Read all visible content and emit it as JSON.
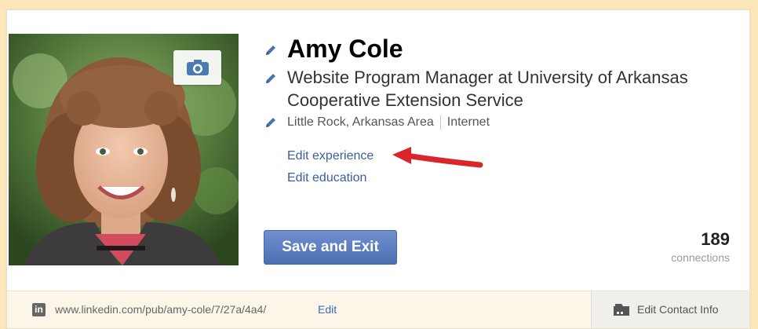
{
  "profile": {
    "name": "Amy Cole",
    "headline": "Website Program Manager at University of Arkansas Cooperative Extension Service",
    "location": "Little Rock, Arkansas Area",
    "industry": "Internet"
  },
  "actions": {
    "edit_experience": "Edit experience",
    "edit_education": "Edit education",
    "save_exit": "Save and Exit"
  },
  "connections": {
    "count": "189",
    "label": "connections"
  },
  "footer": {
    "linkedin_badge": "in",
    "public_url": "www.linkedin.com/pub/amy-cole/7/27a/4a4/",
    "url_edit": "Edit",
    "edit_contact_info": "Edit Contact Info"
  },
  "colors": {
    "accent_link": "#3a5f9a",
    "button": "#5a7bc0",
    "arrow": "#d8262a",
    "background": "#fbe7b9"
  },
  "icons": [
    "camera-icon",
    "pencil-icon",
    "linkedin-icon",
    "contact-card-icon",
    "red-arrow-annotation"
  ]
}
